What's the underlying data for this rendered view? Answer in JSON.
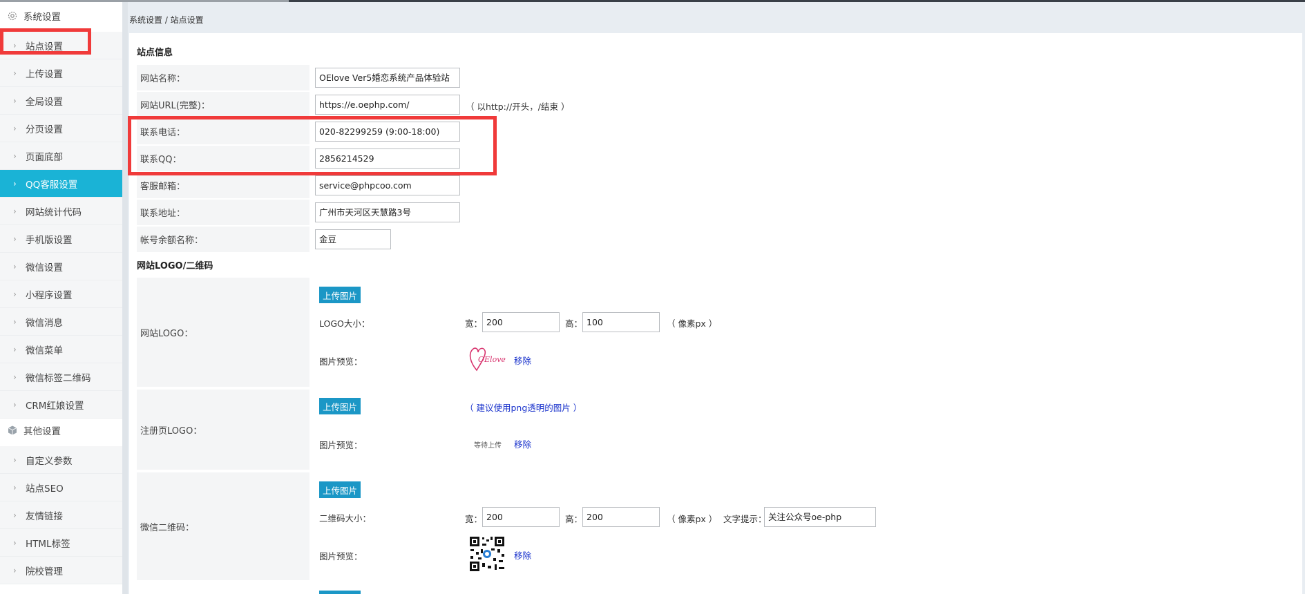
{
  "sidebar": {
    "group1": "系统设置",
    "group2": "其他设置",
    "items": [
      {
        "label": "站点设置"
      },
      {
        "label": "上传设置"
      },
      {
        "label": "全局设置"
      },
      {
        "label": "分页设置"
      },
      {
        "label": "页面底部"
      },
      {
        "label": "QQ客服设置"
      },
      {
        "label": "网站统计代码"
      },
      {
        "label": "手机版设置"
      },
      {
        "label": "微信设置"
      },
      {
        "label": "小程序设置"
      },
      {
        "label": "微信消息"
      },
      {
        "label": "微信菜单"
      },
      {
        "label": "微信标签二维码"
      },
      {
        "label": "CRM红娘设置"
      }
    ],
    "items2": [
      {
        "label": "自定义参数"
      },
      {
        "label": "站点SEO"
      },
      {
        "label": "友情链接"
      },
      {
        "label": "HTML标签"
      },
      {
        "label": "院校管理"
      }
    ],
    "active_index": 5
  },
  "breadcrumb": "系统设置 / 站点设置",
  "site_info": {
    "title": "站点信息",
    "fields": [
      {
        "label": "网站名称：",
        "value": "OElove Ver5婚恋系统产品体验站"
      },
      {
        "label": "网站URL(完整)：",
        "value": "https://e.oephp.com/",
        "hint": "（ 以http://开头，/结束 ）"
      },
      {
        "label": "联系电话：",
        "value": "020-82299259 (9:00-18:00)"
      },
      {
        "label": "联系QQ：",
        "value": "2856214529"
      },
      {
        "label": "客服邮箱：",
        "value": "service@phpcoo.com"
      },
      {
        "label": "联系地址：",
        "value": "广州市天河区天慧路3号"
      },
      {
        "label": "帐号余额名称：",
        "value": "金豆"
      }
    ]
  },
  "logo_section": {
    "title": "网站LOGO/二维码",
    "upload_label": "上传图片",
    "remove_label": "移除",
    "preview_label": "图片预览：",
    "width_label": "宽：",
    "height_label": "高：",
    "px_hint": "（ 像素px ）",
    "site_logo": {
      "label": "网站LOGO：",
      "size_label": "LOGO大小：",
      "width": "200",
      "height": "100",
      "logo_text": "OElove"
    },
    "reg_logo": {
      "label": "注册页LOGO：",
      "hint": "（ 建议使用png透明的图片 ）",
      "waiting": "等待上传"
    },
    "wechat_qr": {
      "label": "微信二维码：",
      "size_label": "二维码大小：",
      "width": "200",
      "height": "200",
      "text_label": "文字提示：",
      "text_value": "关注公众号oe-php"
    }
  },
  "colors": {
    "active": "#1ab3d6",
    "button": "#1b97c6",
    "highlight": "#f03a3a",
    "link": "#1a33cc"
  }
}
